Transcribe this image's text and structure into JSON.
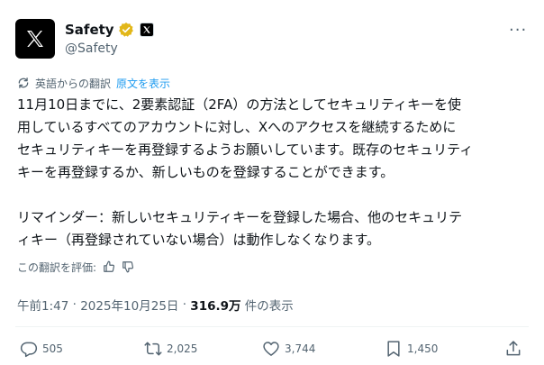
{
  "header": {
    "name": "Safety",
    "handle": "@Safety",
    "more_label": "···"
  },
  "translation": {
    "notice": "英語からの翻訳",
    "show_original": "原文を表示"
  },
  "body": {
    "lines": [
      "11月10日までに、2要素認証（2FA）の方法としてセキュリティキーを使",
      "用しているすべてのアカウントに対し、Xへのアクセスを継続するために",
      "セキュリティキーを再登録するようお願いしています。既存のセキュリティ",
      "キーを再登録するか、新しいものを登録することができます。",
      "リマインダー：新しいセキュリティキーを登録した場合、他のセキュリテ",
      "ィキー（再登録されていない場合）は動作しなくなります。"
    ]
  },
  "rate": {
    "label": "この翻訳を評価:"
  },
  "meta": {
    "time": "午前1:47",
    "separator1": " · ",
    "date": "2025年10月25日",
    "separator2": " · ",
    "views_count": "316.9万",
    "views_label": " 件の表示"
  },
  "actions": {
    "replies": "505",
    "reposts": "2,025",
    "likes": "3,744",
    "bookmarks": "1,450"
  },
  "colors": {
    "accent": "#1d9bf0",
    "verified_gold": "#e2b719",
    "muted": "#536471",
    "text": "#0f1419"
  }
}
